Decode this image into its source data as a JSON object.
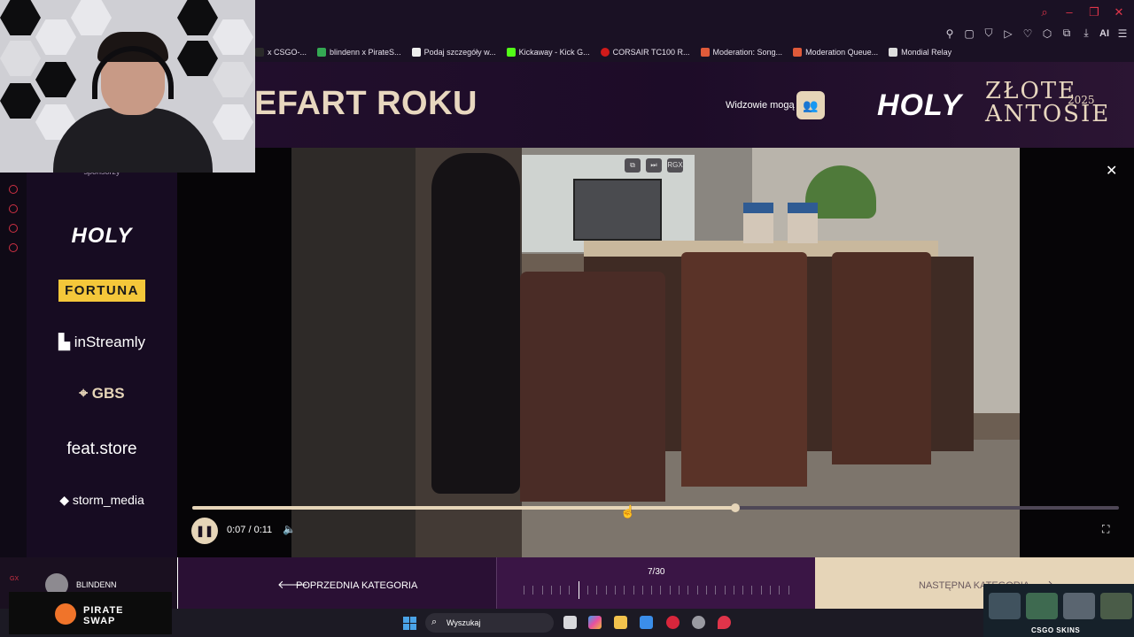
{
  "browser": {
    "bookmarks": [
      {
        "label": "x CSGO-...",
        "color": "#2a2a2a"
      },
      {
        "label": "blindenn x PirateS...",
        "color": "#34a853"
      },
      {
        "label": "Podaj szczegóły w...",
        "color": "#eeeeee"
      },
      {
        "label": "Kickaway - Kick G...",
        "color": "#53fc18"
      },
      {
        "label": "CORSAIR TC100 R...",
        "color": "#d11a1a"
      },
      {
        "label": "Moderation: Song...",
        "color": "#e05a3a"
      },
      {
        "label": "Moderation Queue...",
        "color": "#e05a3a"
      },
      {
        "label": "Mondial Relay",
        "color": "#dddddd"
      }
    ],
    "ai_label": "AI"
  },
  "header": {
    "category_title": "EFART ROKU",
    "viewers_label": "Widzowie mogą",
    "logo_holy": "HOLY",
    "event_logo_line1": "ZŁOTE",
    "event_logo_line2": "ANTOSIE",
    "event_year": "2025"
  },
  "sponsors": {
    "partial_label": "sponsorzy",
    "items": [
      "HOLY",
      "FORTUNA",
      "inStreamly",
      "GBS",
      "feat.store",
      "storm_media"
    ]
  },
  "player": {
    "overlay_badge": "RGX",
    "current_time": "0:07",
    "duration": "0:11",
    "time_display": "0:07 / 0:11",
    "progress_fraction": 0.586,
    "state": "playing"
  },
  "bottom_nav": {
    "username": "BLINDENN",
    "rail_tag": "GX",
    "prev_label": "POPRZEDNIA KATEGORIA",
    "counter": "7/30",
    "current_index": 7,
    "total": 30,
    "next_label": "NASTĘPNA KATEGORIA"
  },
  "taskbar": {
    "search_placeholder": "Wyszukaj"
  },
  "overlays": {
    "pirate_line1": "PIRATE",
    "pirate_line2": "SWAP",
    "csgo_brand": "CSGO SKINS"
  },
  "colors": {
    "accent_gold": "#e6d5b8",
    "panel_purple": "#2a1034",
    "rail_red": "#d03144"
  }
}
